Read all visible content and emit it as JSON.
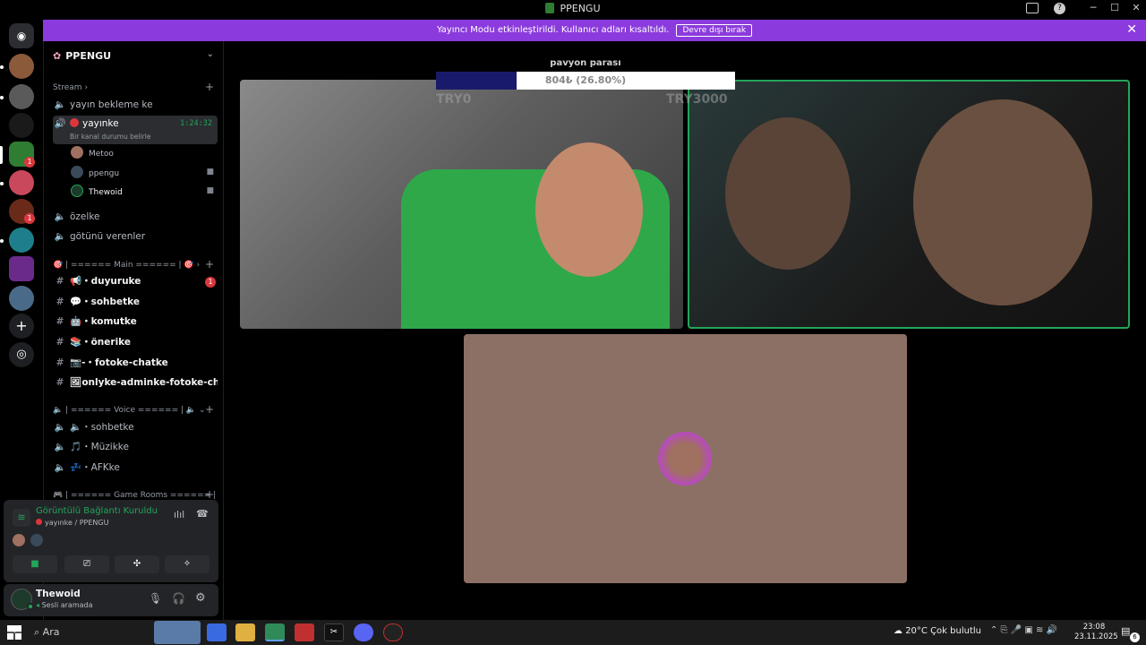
{
  "window": {
    "title": "PPENGU"
  },
  "banner": {
    "text": "Yayıncı Modu etkinleştirildi. Kullanıcı adları kısaltıldı.",
    "button": "Devre dışı bırak"
  },
  "rail": {
    "badges": [
      "1",
      "1"
    ]
  },
  "server": {
    "name": "PPENGU",
    "categories": {
      "stream": "Stream",
      "main": "🎯 | ====== Main ====== | 🎯",
      "voice": "🔈 | ====== Voice ====== | 🔈",
      "game": "🎮 | ====== Game Rooms ====== | 🎮"
    },
    "stream_channels": [
      "yayın bekleme ke",
      "özelke",
      "götünü verenler"
    ],
    "active_channel": {
      "name": "yayınke",
      "timer": "1:24:32",
      "status": "Bir kanal durumu belirle"
    },
    "voice_users": [
      "Metoo",
      "ppengu",
      "Thewoid"
    ],
    "text_channels": [
      {
        "name": "duyuruke",
        "prefix": "📢・",
        "badge": "1"
      },
      {
        "name": "sohbetke",
        "prefix": "💬・"
      },
      {
        "name": "komutke",
        "prefix": "🤖・"
      },
      {
        "name": "önerike",
        "prefix": "📚・"
      },
      {
        "name": "fotoke-chatke",
        "prefix": "📷-・"
      },
      {
        "name": "onlyke-adminke-fotoke-chat...",
        "prefix": "🖼"
      }
    ],
    "voice_channels": [
      {
        "name": "sohbetke",
        "prefix": "🔈・"
      },
      {
        "name": "Müzikke",
        "prefix": "🎵・"
      },
      {
        "name": "AFKke",
        "prefix": "💤・"
      }
    ]
  },
  "voice_panel": {
    "status": "Görüntülü Bağlantı Kuruldu",
    "location": "yayınke / PPENGU"
  },
  "user_panel": {
    "name": "Thewoid",
    "status": "Sesli aramada"
  },
  "overlay": {
    "title": "pavyon parası",
    "progress_text": "804₺ (26.80%)",
    "progress": 0.268,
    "left_label": "TRY0",
    "right_label": "TRY3000"
  },
  "taskbar": {
    "search": "Ara",
    "weather": "20°C  Çok bulutlu",
    "time": "23:08",
    "date": "23.11.2025",
    "notif": "6"
  },
  "colors": {
    "accent": "#8b3bdd",
    "connected": "#23a55a",
    "danger": "#da373c",
    "progress_fill": "#1a1a6b",
    "avatar_tile": "#8c7066"
  }
}
